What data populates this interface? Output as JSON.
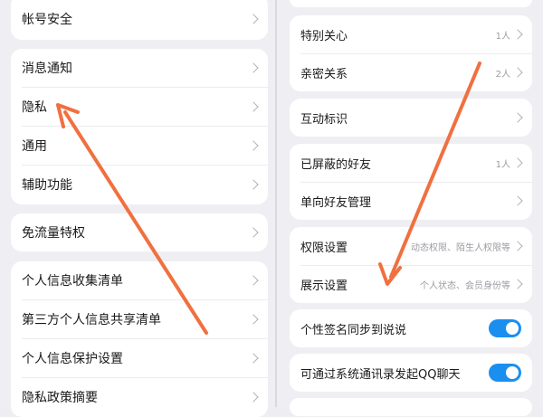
{
  "left": {
    "account_security": "帐号安全",
    "notifications": "消息通知",
    "privacy": "隐私",
    "general": "通用",
    "accessibility": "辅助功能",
    "free_data": "免流量特权",
    "info_collection": "个人信息收集清单",
    "third_party_sharing": "第三方个人信息共享清单",
    "info_protection": "个人信息保护设置",
    "privacy_summary": "隐私政策摘要"
  },
  "right": {
    "special_care": {
      "label": "特别关心",
      "value": "1人"
    },
    "close_relations": {
      "label": "亲密关系",
      "value": "2人"
    },
    "interaction_badges": {
      "label": "互动标识"
    },
    "blocked_friends": {
      "label": "已屏蔽的好友",
      "value": "1人"
    },
    "one_way_friends": {
      "label": "单向好友管理"
    },
    "permission_settings": {
      "label": "权限设置",
      "value": "动态权限、陌生人权限等"
    },
    "display_settings": {
      "label": "展示设置",
      "value": "个人状态、会员身份等"
    },
    "sync_signature": {
      "label": "个性签名同步到说说",
      "enabled": true
    },
    "contacts_call": {
      "label": "可通过系统通讯录发起QQ聊天",
      "enabled": true
    }
  },
  "colors": {
    "accent_toggle": "#1a8ff0",
    "annotation_arrow": "#f07040"
  }
}
